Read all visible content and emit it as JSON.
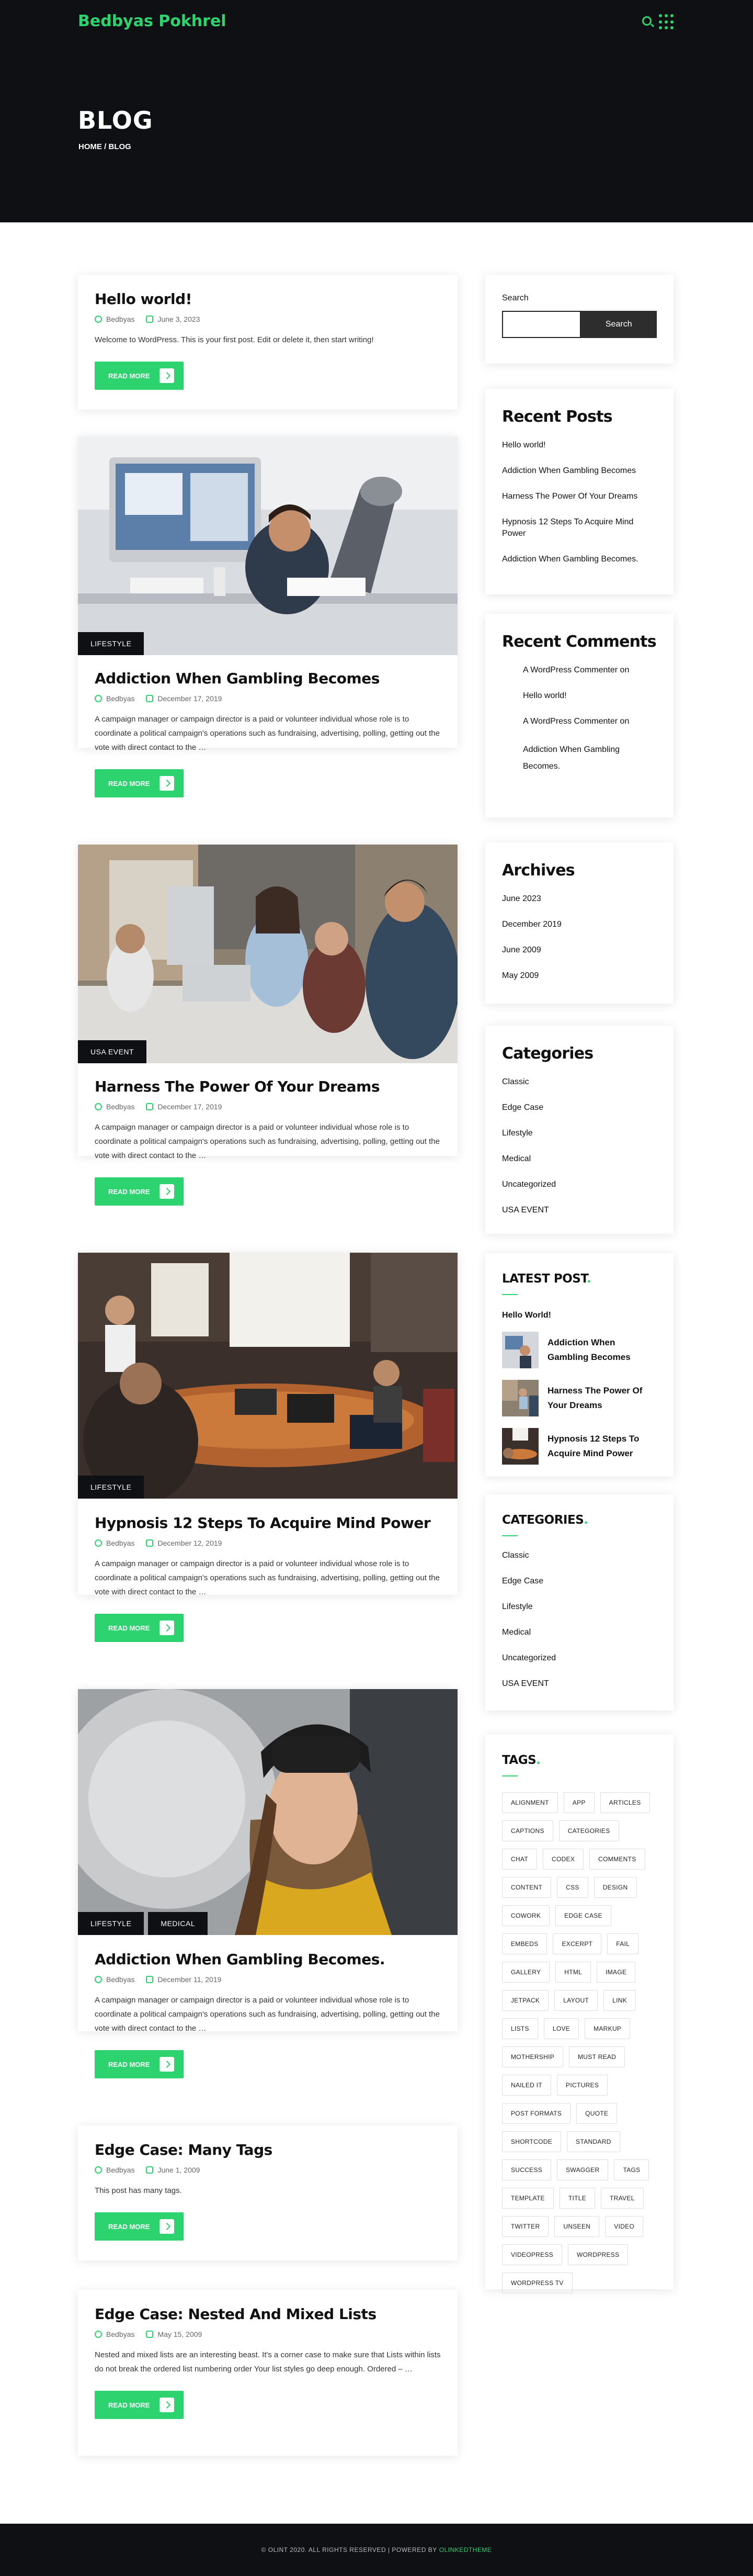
{
  "site": {
    "logo": "Bedbyas Pokhrel"
  },
  "hero": {
    "title": "BLOG",
    "breadcrumb": "HOME / BLOG"
  },
  "posts": [
    {
      "title": "Hello world!",
      "author": "Bedbyas",
      "date": "June 3, 2023",
      "excerpt": "Welcome to WordPress. This is your first post. Edit or delete it, then start writing!",
      "read_more": "READ MORE"
    },
    {
      "title": "Addiction When Gambling Becomes",
      "author": "Bedbyas",
      "date": "December 17, 2019",
      "excerpt": "A campaign manager or campaign director is a paid or volunteer individual whose role is to coordinate a political campaign's operations such as fundraising, advertising, polling, getting out the vote with direct contact to the …",
      "read_more": "READ MORE",
      "tags": [
        "LIFESTYLE"
      ]
    },
    {
      "title": "Harness The Power Of Your Dreams",
      "author": "Bedbyas",
      "date": "December 17, 2019",
      "excerpt": "A campaign manager or campaign director is a paid or volunteer individual whose role is to coordinate a political campaign's operations such as fundraising, advertising, polling, getting out the vote with direct contact to the …",
      "read_more": "READ MORE",
      "tags": [
        "USA EVENT"
      ]
    },
    {
      "title": "Hypnosis 12 Steps To Acquire Mind Power",
      "author": "Bedbyas",
      "date": "December 12, 2019",
      "excerpt": "A campaign manager or campaign director is a paid or volunteer individual whose role is to coordinate a political campaign's operations such as fundraising, advertising, polling, getting out the vote with direct contact to the …",
      "read_more": "READ MORE",
      "tags": [
        "LIFESTYLE"
      ]
    },
    {
      "title": "Addiction When Gambling Becomes.",
      "author": "Bedbyas",
      "date": "December 11, 2019",
      "excerpt": "A campaign manager or campaign director is a paid or volunteer individual whose role is to coordinate a political campaign's operations such as fundraising, advertising, polling, getting out the vote with direct contact to the …",
      "read_more": "READ MORE",
      "tags": [
        "LIFESTYLE",
        "MEDICAL"
      ]
    },
    {
      "title": "Edge Case: Many Tags",
      "author": "Bedbyas",
      "date": "June 1, 2009",
      "excerpt": "This post has many tags.",
      "read_more": "READ MORE"
    },
    {
      "title": "Edge Case: Nested And Mixed Lists",
      "author": "Bedbyas",
      "date": "May 15, 2009",
      "excerpt": "Nested and mixed lists are an interesting beast. It's a corner case to make sure that Lists within lists do not break the ordered list numbering order Your list styles go deep enough. Ordered – …",
      "read_more": "READ MORE"
    }
  ],
  "sidebar": {
    "search": {
      "label": "Search",
      "button": "Search",
      "placeholder": ""
    },
    "recent_posts": {
      "title": "Recent Posts",
      "items": [
        "Hello world!",
        "Addiction When Gambling Becomes",
        "Harness The Power Of Your Dreams",
        "Hypnosis 12 Steps To Acquire Mind Power",
        "Addiction When Gambling Becomes."
      ]
    },
    "recent_comments": {
      "title": "Recent Comments",
      "items": [
        "A WordPress Commenter on",
        "Hello world!",
        "A WordPress Commenter on",
        "Addiction When Gambling Becomes."
      ]
    },
    "archives": {
      "title": "Archives",
      "items": [
        "June 2023",
        "December 2019",
        "June 2009",
        "May 2009"
      ]
    },
    "categories": {
      "title": "Categories",
      "items": [
        "Classic",
        "Edge Case",
        "Lifestyle",
        "Medical",
        "Uncategorized",
        "USA EVENT"
      ]
    },
    "latest": {
      "title": "LATEST POST",
      "first": "Hello World!",
      "items": [
        "Addiction When Gambling Becomes",
        "Harness The Power Of Your Dreams",
        "Hypnosis 12 Steps To Acquire Mind Power"
      ]
    },
    "categories2": {
      "title": "CATEGORIES",
      "items": [
        "Classic",
        "Edge Case",
        "Lifestyle",
        "Medical",
        "Uncategorized",
        "USA EVENT"
      ]
    },
    "tags": {
      "title": "TAGS",
      "items": [
        "ALIGNMENT",
        "APP",
        "ARTICLES",
        "CAPTIONS",
        "CATEGORIES",
        "CHAT",
        "CODEX",
        "COMMENTS",
        "CONTENT",
        "CSS",
        "DESIGN",
        "COWORK",
        "EDGE CASE",
        "EMBEDS",
        "EXCERPT",
        "FAIL",
        "GALLERY",
        "HTML",
        "IMAGE",
        "JETPACK",
        "LAYOUT",
        "LINK",
        "LISTS",
        "LOVE",
        "MARKUP",
        "MOTHERSHIP",
        "MUST READ",
        "NAILED IT",
        "PICTURES",
        "POST FORMATS",
        "QUOTE",
        "SHORTCODE",
        "STANDARD",
        "SUCCESS",
        "SWAGGER",
        "TAGS",
        "TEMPLATE",
        "TITLE",
        "TRAVEL",
        "TWITTER",
        "UNSEEN",
        "VIDEO",
        "VIDEOPRESS",
        "WORDPRESS",
        "WORDPRESS TV"
      ]
    }
  },
  "footer": {
    "text": "© OLINT 2020. ALL RIGHTS RESERVED | POWERED BY",
    "link": "OLINKEDTHEME"
  },
  "colors": {
    "accent": "#2dd36f",
    "dark": "#0f1013"
  }
}
